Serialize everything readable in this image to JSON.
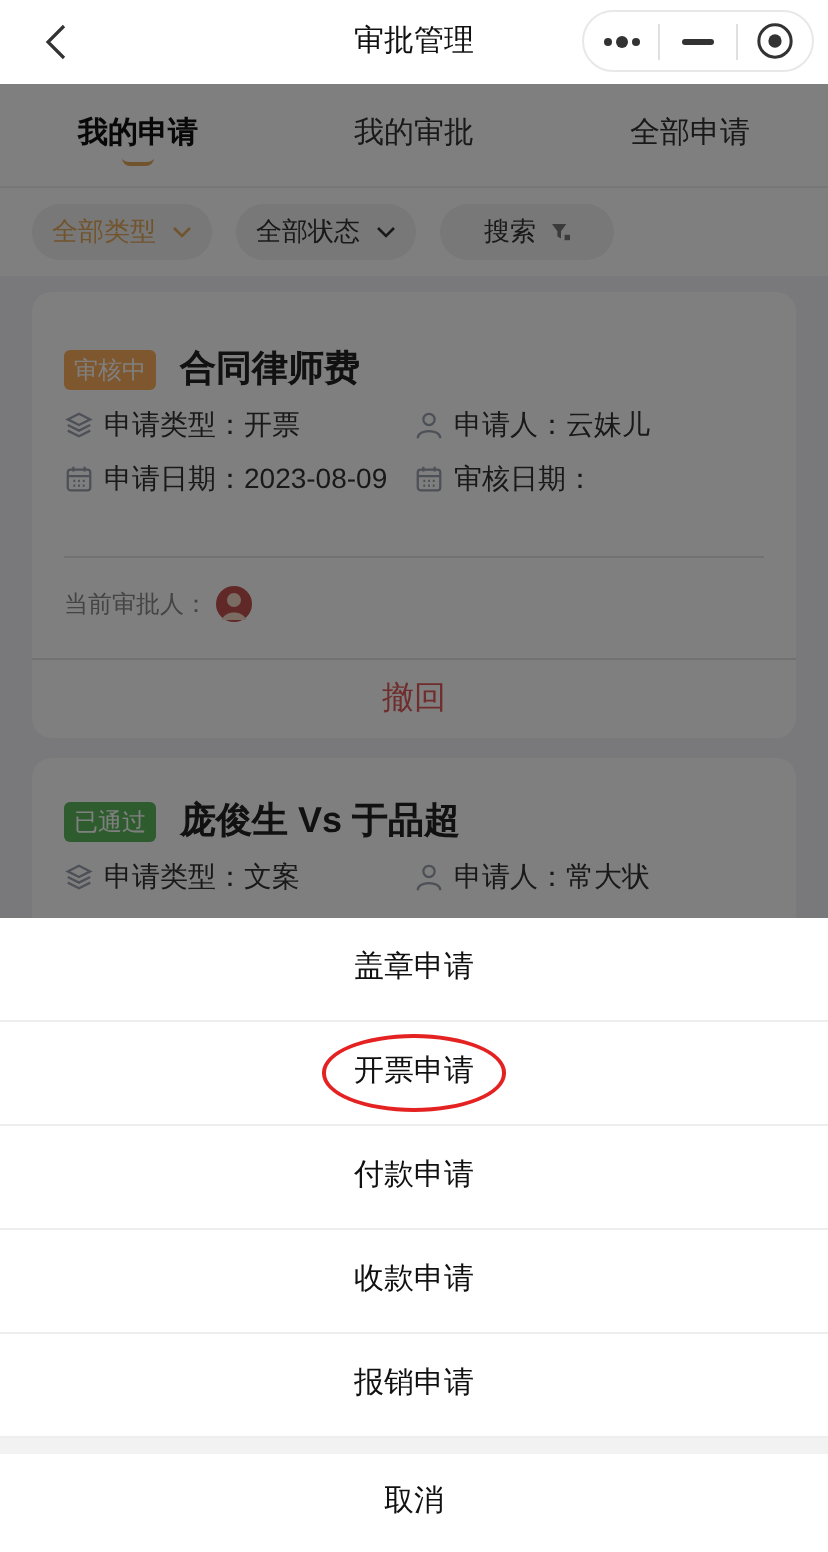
{
  "nav": {
    "title": "审批管理"
  },
  "tabs": [
    {
      "label": "我的申请",
      "selected": true
    },
    {
      "label": "我的审批",
      "selected": false
    },
    {
      "label": "全部申请",
      "selected": false
    }
  ],
  "filters": [
    {
      "label": "全部类型",
      "selected": true,
      "kind": "dropdown"
    },
    {
      "label": "全部状态",
      "selected": false,
      "kind": "dropdown"
    },
    {
      "label": "搜索",
      "selected": false,
      "kind": "search"
    }
  ],
  "cards": [
    {
      "status": "审核中",
      "color": "#7f572e",
      "title": "合同律师费",
      "fields": [
        {
          "kind": "type",
          "label": "申请类型：",
          "value": "开票"
        },
        {
          "kind": "person",
          "label": "申请人：",
          "value": "云妹儿"
        },
        {
          "kind": "date",
          "label": "申请日期：",
          "value": "2023-08-09"
        },
        {
          "kind": "date",
          "label": "审核日期："
        }
      ],
      "approver_label": "当前审批人：",
      "action": "撤回"
    },
    {
      "status": "已通过",
      "color": "#2e5c2e",
      "title": "庞俊生 Vs 于品超",
      "fields": [
        {
          "kind": "type",
          "label": "申请类型：",
          "value": "文案"
        },
        {
          "kind": "person",
          "label": "申请人：",
          "value": "常大状"
        }
      ]
    }
  ],
  "sheet": {
    "options": [
      {
        "label": "盖章申请",
        "circled": false
      },
      {
        "label": "开票申请",
        "circled": true
      },
      {
        "label": "付款申请",
        "circled": false
      },
      {
        "label": "收款申请",
        "circled": false
      },
      {
        "label": "报销申请",
        "circled": false
      }
    ],
    "cancel": "取消"
  }
}
